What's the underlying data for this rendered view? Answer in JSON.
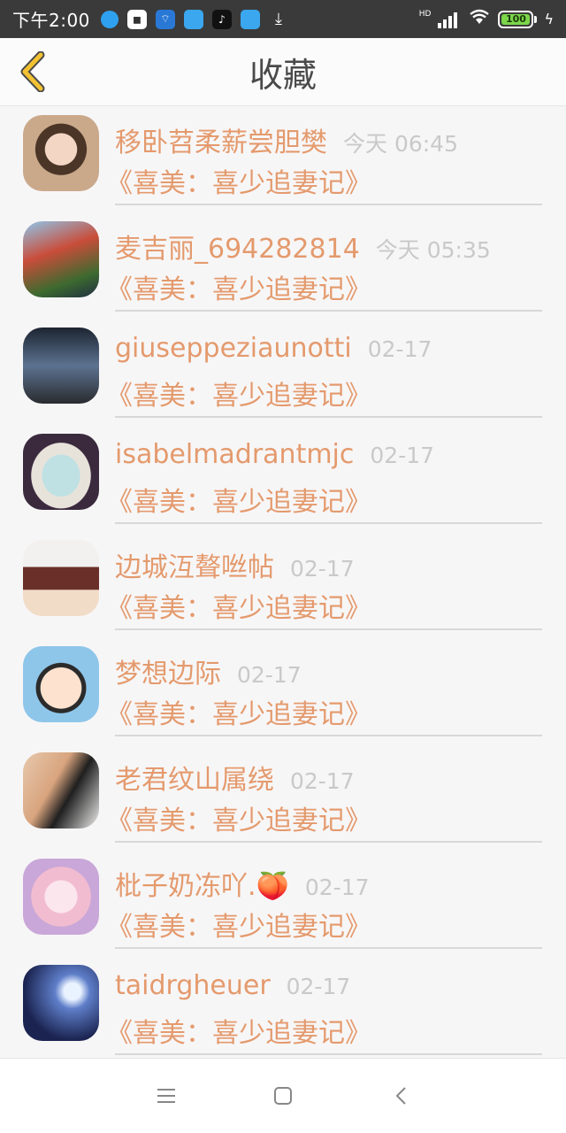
{
  "status_bar": {
    "time": "下午2:00",
    "network_label": "HD",
    "battery": "100"
  },
  "header": {
    "title": "收藏",
    "back_icon": "chevron-left-icon"
  },
  "items": [
    {
      "username": "移卧苕柔薪尝胆樊",
      "time": "今天 06:45",
      "book": "《喜美：喜少追妻记》"
    },
    {
      "username": "麦吉丽_694282814",
      "time": "今天 05:35",
      "book": "《喜美：喜少追妻记》"
    },
    {
      "username": "giuseppeziaunotti",
      "time": "02-17",
      "book": "《喜美：喜少追妻记》"
    },
    {
      "username": "isabelmadrantmjc",
      "time": "02-17",
      "book": "《喜美：喜少追妻记》"
    },
    {
      "username": "边城沍聱咝帖",
      "time": "02-17",
      "book": "《喜美：喜少追妻记》"
    },
    {
      "username": "梦想边际",
      "time": "02-17",
      "book": "《喜美：喜少追妻记》"
    },
    {
      "username": "老君纹山属绕",
      "time": "02-17",
      "book": "《喜美：喜少追妻记》"
    },
    {
      "username": "枇子奶冻吖.🍑",
      "time": "02-17",
      "book": "《喜美：喜少追妻记》"
    },
    {
      "username": "taidrgheuer",
      "time": "02-17",
      "book": "《喜美：喜少追妻记》"
    }
  ],
  "colors": {
    "accent": "#e49a6d",
    "time_gray": "#c9c9c9",
    "back_yellow": "#f2c232"
  },
  "nav": {
    "menu_icon": "menu-icon",
    "home_icon": "home-square-icon",
    "back_icon": "back-triangle-icon"
  }
}
